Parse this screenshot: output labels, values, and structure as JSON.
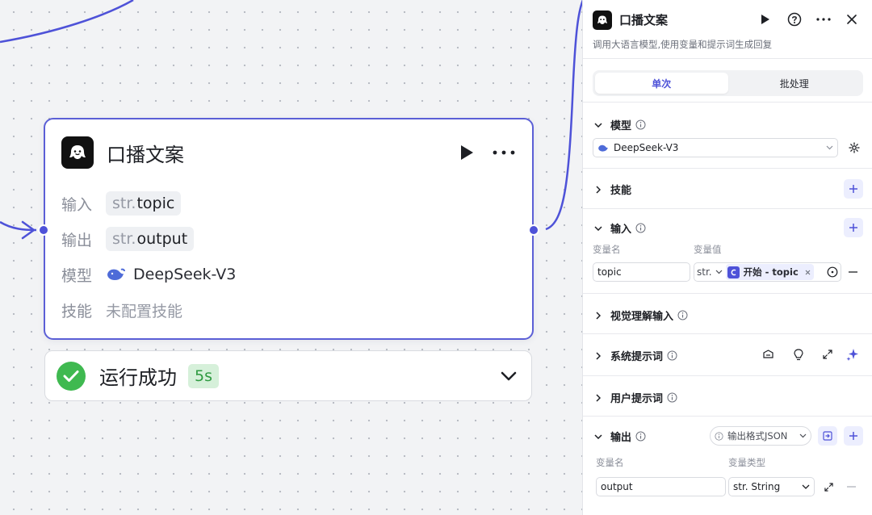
{
  "node": {
    "title": "口播文案",
    "input_label": "输入",
    "input_type": "str.",
    "input_name": "topic",
    "output_label": "输出",
    "output_type": "str.",
    "output_name": "output",
    "model_label": "模型",
    "model_value": "DeepSeek-V3",
    "skill_label": "技能",
    "skill_value": "未配置技能"
  },
  "status": {
    "text": "运行成功",
    "duration": "5s"
  },
  "panel": {
    "title": "口播文案",
    "description": "调用大语言模型,使用变量和提示词生成回复",
    "tabs": [
      "单次",
      "批处理"
    ],
    "active_tab": "单次",
    "model": {
      "title": "模型",
      "value": "DeepSeek-V3"
    },
    "skills": {
      "title": "技能"
    },
    "input": {
      "title": "输入",
      "col_name": "变量名",
      "col_value": "变量值",
      "var_name": "topic",
      "var_type": "str.",
      "ref_label": "开始 - topic"
    },
    "vision": {
      "title": "视觉理解输入"
    },
    "system_prompt": {
      "title": "系统提示词"
    },
    "user_prompt": {
      "title": "用户提示词"
    },
    "output": {
      "title": "输出",
      "format_label": "输出格式JSON",
      "col_name": "变量名",
      "col_type": "变量类型",
      "var_name": "output",
      "var_type": "str. String"
    }
  },
  "colors": {
    "accent": "#4e52d8",
    "success": "#3fb950",
    "node_border": "#5b5fd6"
  }
}
